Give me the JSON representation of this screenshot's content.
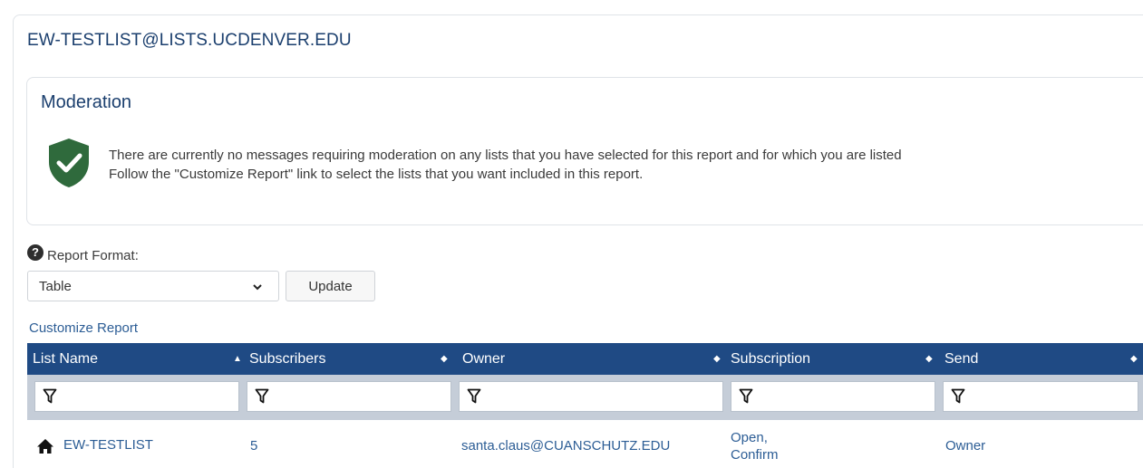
{
  "list_title": "EW-TESTLIST@LISTS.UCDENVER.EDU",
  "moderation": {
    "title": "Moderation",
    "message_line1": "There are currently no messages requiring moderation on any lists that you have selected for this report and for which you are listed",
    "message_line2": "Follow the \"Customize Report\" link to select the lists that you want included in this report."
  },
  "report_format": {
    "help_symbol": "?",
    "label": "Report Format:",
    "selected": "Table",
    "update_label": "Update"
  },
  "customize_link": "Customize Report",
  "table": {
    "columns": [
      {
        "label": "List Name",
        "sort": "▲"
      },
      {
        "label": "Subscribers",
        "sort": "◆"
      },
      {
        "label": "Owner",
        "sort": "◆"
      },
      {
        "label": "Subscription",
        "sort": "◆"
      },
      {
        "label": "Send",
        "sort": "◆"
      }
    ],
    "rows": [
      {
        "list_name": "EW-TESTLIST",
        "subscribers": "5",
        "owner": "santa.claus@CUANSCHUTZ.EDU",
        "subscription_line1": "Open,",
        "subscription_line2": "Confirm",
        "send": "Owner"
      }
    ]
  },
  "colors": {
    "header_bg": "#1f4a84",
    "filter_bg": "#c5cdd8",
    "link": "#2c5d95",
    "shield": "#2f6a3c"
  },
  "icons": {
    "shield": "shield-check-icon",
    "help": "question-circle-icon",
    "filter": "filter-icon",
    "home": "home-icon",
    "caret": "chevron-down-icon"
  }
}
